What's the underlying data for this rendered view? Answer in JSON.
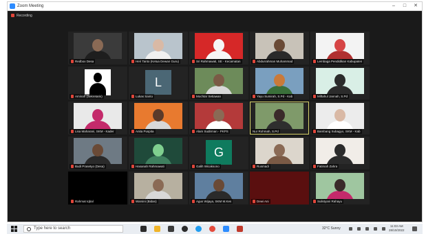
{
  "window": {
    "title": "Zoom Meeting",
    "recording_label": "Recording",
    "controls": {
      "minimize": "–",
      "maximize": "□",
      "close": "✕"
    }
  },
  "colors": {
    "accent": "#2d8cff",
    "mute": "#e0463a",
    "active_speaker": "#d7d36a",
    "background": "#1a1a1a"
  },
  "participants": [
    {
      "name": "Redbox Desa",
      "muted": true
    },
    {
      "name": "Heri Tanto (Ketua Dewan Guru)",
      "muted": true
    },
    {
      "name": "Sri Rahmawati, SE - Kecamatan",
      "muted": true
    },
    {
      "name": "Abdurrahman Muhammad",
      "muted": true
    },
    {
      "name": "Lembaga Pendidikan Kabupaten",
      "muted": true
    },
    {
      "name": "Aminah (Sekretaris)",
      "muted": true
    },
    {
      "name": "Lukas Santo",
      "muted": true,
      "avatar_letter": "L"
    },
    {
      "name": "Mochtar Setiawan",
      "muted": true
    },
    {
      "name": "Yayu Sumirah, S.Pd - Kab",
      "muted": true
    },
    {
      "name": "Miftahul Jannah, S.Pd",
      "muted": true
    },
    {
      "name": "Lisa Maharani, SKM - Kader",
      "muted": true
    },
    {
      "name": "Anita Puspita",
      "muted": true
    },
    {
      "name": "Alam Sudirman - PKPS",
      "muted": true
    },
    {
      "name": "Nur Rohmah, S.Pd",
      "muted": false,
      "active": true
    },
    {
      "name": "Bambang Subagyo, SKM - Kab",
      "muted": true
    },
    {
      "name": "Budi Prasetyo (Desa)",
      "muted": true
    },
    {
      "name": "Hasanah Rahmawati",
      "muted": true
    },
    {
      "name": "Galih Wicaksono",
      "muted": true,
      "avatar_letter": "G"
    },
    {
      "name": "Rusmadi",
      "muted": true
    },
    {
      "name": "Fatimah Zahra",
      "muted": true
    },
    {
      "name": "Rahmat Iqbal",
      "muted": true
    },
    {
      "name": "Warsini (Bidan)",
      "muted": true
    },
    {
      "name": "Agus Wijaya, SKM M.Kes",
      "muted": true
    },
    {
      "name": "Dewi Ani",
      "muted": true
    },
    {
      "name": "Sulistyani Rahayu",
      "muted": true
    }
  ],
  "taskbar": {
    "search_placeholder": "Type here to search",
    "weather": "32°C Sunny",
    "time": "11:03 AM",
    "date": "28/10/2022"
  }
}
